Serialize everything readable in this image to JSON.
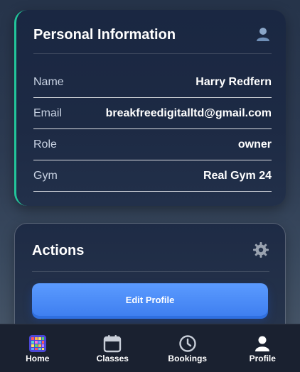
{
  "personal_info": {
    "title": "Personal Information",
    "header_icon": "user-icon",
    "rows": [
      {
        "label": "Name",
        "value": "Harry Redfern"
      },
      {
        "label": "Email",
        "value": "breakfreedigitalltd@gmail.com"
      },
      {
        "label": "Role",
        "value": "owner"
      },
      {
        "label": "Gym",
        "value": "Real Gym 24"
      }
    ],
    "accent_color": "#22c59a"
  },
  "actions": {
    "title": "Actions",
    "header_icon": "gear-icon",
    "edit_profile_label": "Edit Profile",
    "button_color": "#4a8cf7"
  },
  "bottom_nav": {
    "items": [
      {
        "label": "Home",
        "icon": "home-grid-icon"
      },
      {
        "label": "Classes",
        "icon": "calendar-icon"
      },
      {
        "label": "Bookings",
        "icon": "clock-icon"
      },
      {
        "label": "Profile",
        "icon": "profile-icon"
      }
    ]
  }
}
